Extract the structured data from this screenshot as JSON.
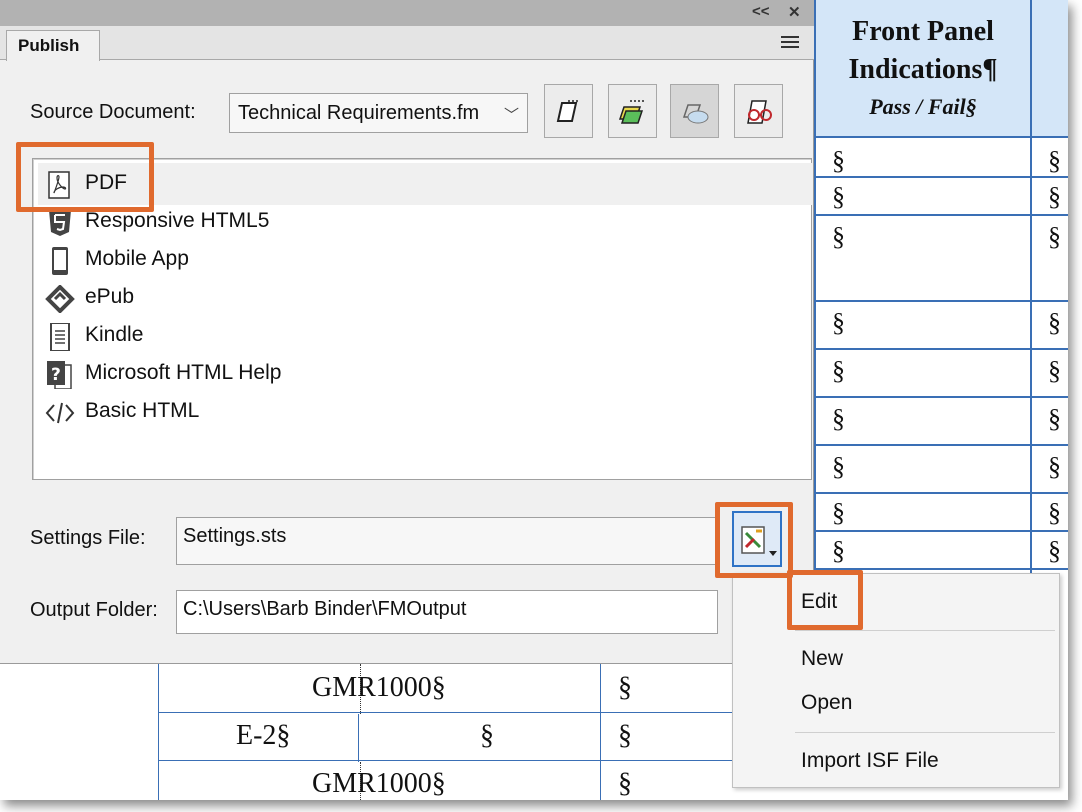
{
  "panel": {
    "tab_label": "Publish",
    "collapse_glyph": "<<",
    "close_glyph": "✕",
    "menu_icon": "hamburger-icon"
  },
  "source": {
    "label": "Source Document:",
    "selected": "Technical Requirements.fm",
    "toolbar_icons": [
      "new-settings-icon",
      "publish-icon",
      "cloud-icon",
      "view-output-icon"
    ]
  },
  "outputs": [
    {
      "label": "PDF",
      "icon": "pdf-icon"
    },
    {
      "label": "Responsive HTML5",
      "icon": "html5-icon"
    },
    {
      "label": "Mobile App",
      "icon": "mobile-icon"
    },
    {
      "label": "ePub",
      "icon": "epub-icon"
    },
    {
      "label": "Kindle",
      "icon": "kindle-icon"
    },
    {
      "label": "Microsoft HTML Help",
      "icon": "help-icon"
    },
    {
      "label": "Basic HTML",
      "icon": "code-icon"
    }
  ],
  "settings": {
    "label": "Settings File:",
    "value": "Settings.sts"
  },
  "output_folder": {
    "label": "Output Folder:",
    "value": "C:\\Users\\Barb Binder\\FMOutput"
  },
  "context_menu": {
    "items": [
      "Edit",
      "New",
      "Open",
      "Import ISF File"
    ]
  },
  "doc_table": {
    "header_line1": "Front Panel",
    "header_line2": "Indications¶",
    "header_line3": "Pass / Fail§",
    "section_mark": "§",
    "bottom_row1": "GMR1000§",
    "bottom_row2_a": "E-2§",
    "bottom_row3": "GMR1000§"
  },
  "colors": {
    "highlight": "#e06a2e",
    "table_line": "#3a6fb5",
    "header_fill": "#d4e6f8"
  }
}
